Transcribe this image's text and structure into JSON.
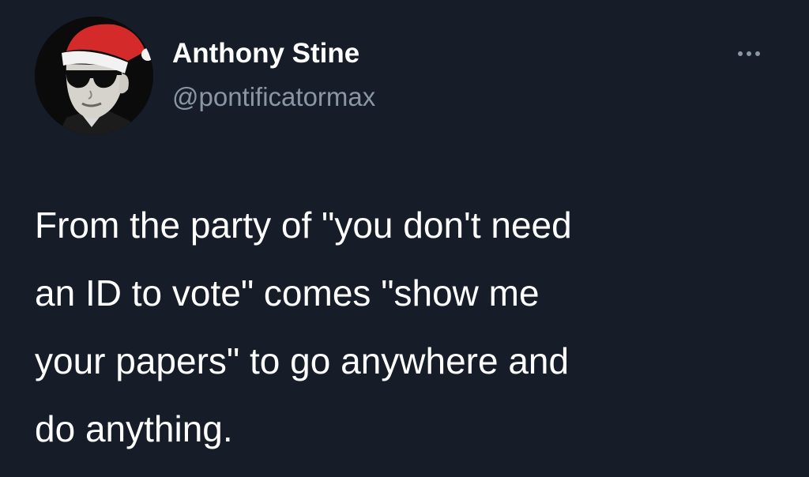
{
  "author": {
    "name": "Anthony Stine",
    "handle": "@pontificatormax"
  },
  "avatar": {
    "icon": "avatar-man-santa-hat-sunglasses"
  },
  "more_icon": "more-horizontal-icon",
  "tweet": {
    "lines": [
      "From the party of \"you don't need",
      "an ID to vote\" comes \"show me",
      "your papers\" to go anywhere and",
      "do anything."
    ]
  },
  "colors": {
    "background": "#161d29",
    "text": "#ffffff",
    "secondary": "#8a96a3",
    "hat_red": "#d42a2a"
  }
}
